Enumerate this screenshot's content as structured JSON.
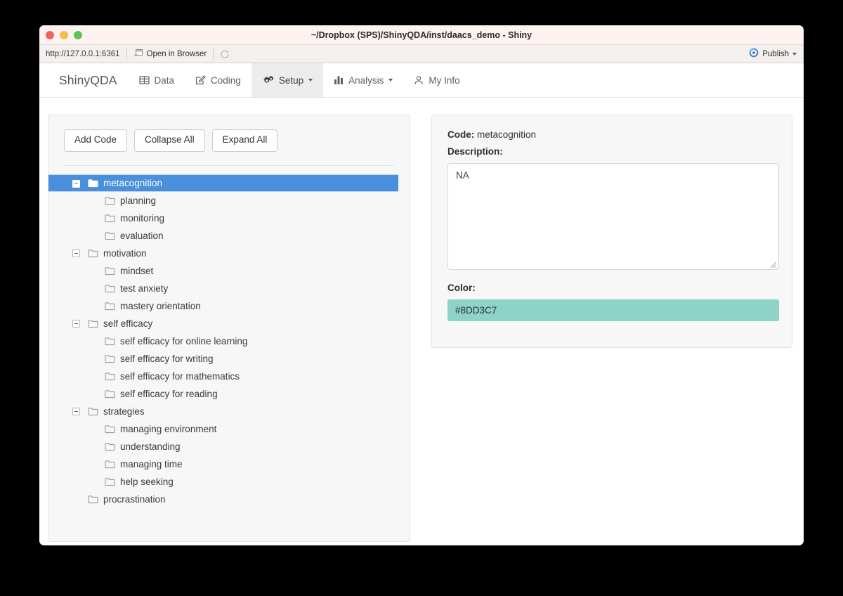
{
  "window": {
    "title": "~/Dropbox (SPS)/ShinyQDA/inst/daacs_demo - Shiny"
  },
  "browser_toolbar": {
    "url": "http://127.0.0.1:6361",
    "open_in_browser_label": "Open in Browser",
    "refresh_icon": "refresh-icon",
    "publish_label": "Publish",
    "publish_icon": "publish-icon"
  },
  "navbar": {
    "brand": "ShinyQDA",
    "items": [
      {
        "label": "Data",
        "icon": "table-icon",
        "active": false,
        "caret": false
      },
      {
        "label": "Coding",
        "icon": "edit-pencil-icon",
        "active": false,
        "caret": false
      },
      {
        "label": "Setup",
        "icon": "cogs-icon",
        "active": true,
        "caret": true
      },
      {
        "label": "Analysis",
        "icon": "bar-chart-icon",
        "active": false,
        "caret": true
      },
      {
        "label": "My Info",
        "icon": "user-icon",
        "active": false,
        "caret": false
      }
    ]
  },
  "left_panel": {
    "buttons": [
      {
        "label": "Add Code"
      },
      {
        "label": "Collapse All"
      },
      {
        "label": "Expand All"
      }
    ],
    "tree": [
      {
        "label": "metacognition",
        "depth": 0,
        "toggle": true,
        "selected": true
      },
      {
        "label": "planning",
        "depth": 1,
        "toggle": false,
        "selected": false
      },
      {
        "label": "monitoring",
        "depth": 1,
        "toggle": false,
        "selected": false
      },
      {
        "label": "evaluation",
        "depth": 1,
        "toggle": false,
        "selected": false
      },
      {
        "label": "motivation",
        "depth": 0,
        "toggle": true,
        "selected": false
      },
      {
        "label": "mindset",
        "depth": 1,
        "toggle": false,
        "selected": false
      },
      {
        "label": "test anxiety",
        "depth": 1,
        "toggle": false,
        "selected": false
      },
      {
        "label": "mastery orientation",
        "depth": 1,
        "toggle": false,
        "selected": false
      },
      {
        "label": "self efficacy",
        "depth": 0,
        "toggle": true,
        "selected": false
      },
      {
        "label": "self efficacy for online learning",
        "depth": 1,
        "toggle": false,
        "selected": false
      },
      {
        "label": "self efficacy for writing",
        "depth": 1,
        "toggle": false,
        "selected": false
      },
      {
        "label": "self efficacy for mathematics",
        "depth": 1,
        "toggle": false,
        "selected": false
      },
      {
        "label": "self efficacy for reading",
        "depth": 1,
        "toggle": false,
        "selected": false
      },
      {
        "label": "strategies",
        "depth": 0,
        "toggle": true,
        "selected": false
      },
      {
        "label": "managing environment",
        "depth": 1,
        "toggle": false,
        "selected": false
      },
      {
        "label": "understanding",
        "depth": 1,
        "toggle": false,
        "selected": false
      },
      {
        "label": "managing time",
        "depth": 1,
        "toggle": false,
        "selected": false
      },
      {
        "label": "help seeking",
        "depth": 1,
        "toggle": false,
        "selected": false
      },
      {
        "label": "procrastination",
        "depth": 0,
        "toggle": false,
        "selected": false
      }
    ]
  },
  "right_panel": {
    "code_label": "Code:",
    "code_value": "metacognition",
    "description_label": "Description:",
    "description_value": "NA",
    "color_label": "Color:",
    "color_value": "#8DD3C7",
    "color_swatch": "#8DD3C7"
  }
}
